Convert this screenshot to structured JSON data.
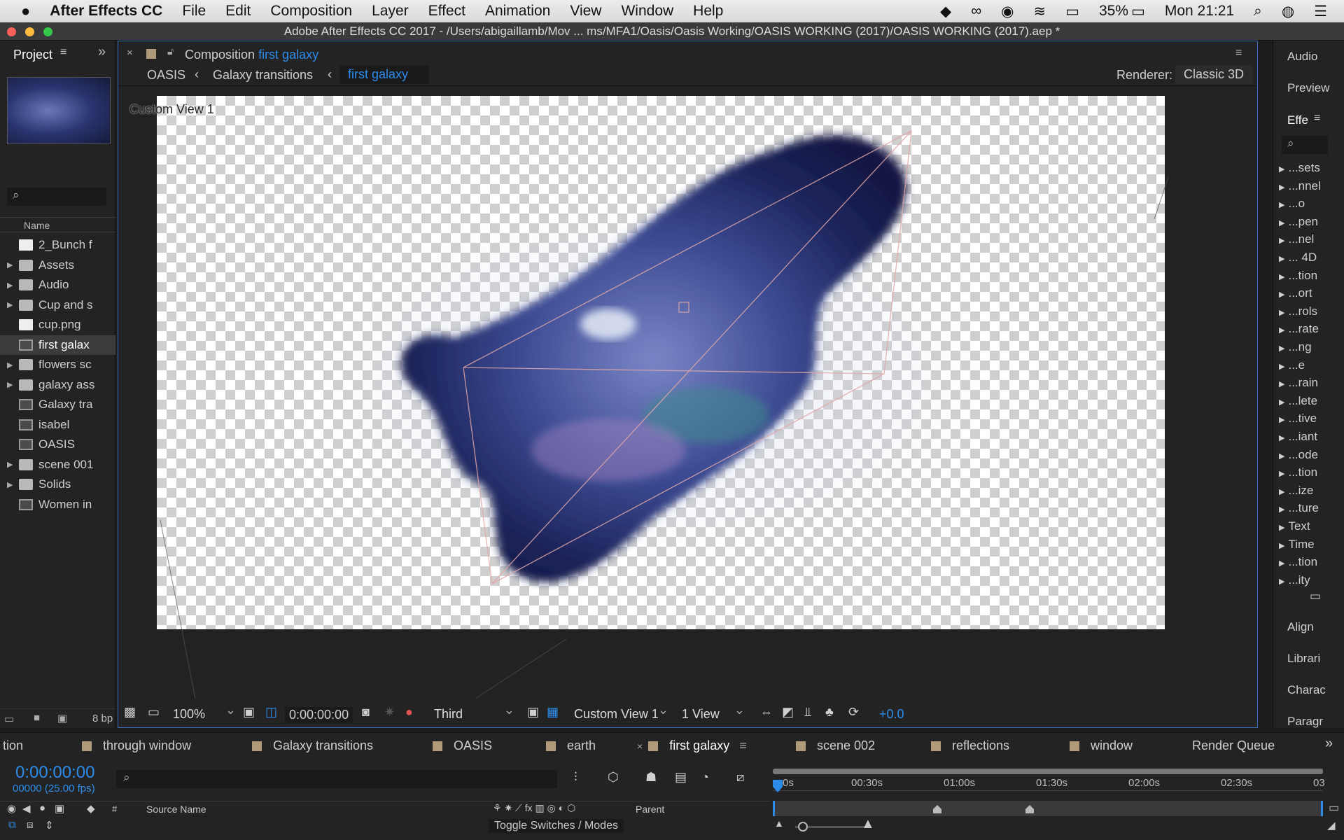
{
  "menubar": {
    "app": "After Effects CC",
    "items": [
      "File",
      "Edit",
      "Composition",
      "Layer",
      "Effect",
      "Animation",
      "View",
      "Window",
      "Help"
    ],
    "battery": "35%",
    "clock": "Mon 21:21"
  },
  "window_title": "Adobe After Effects CC 2017 - /Users/abigaillamb/Mov ... ms/MFA1/Oasis/Oasis Working/OASIS WORKING (2017)/OASIS WORKING (2017).aep *",
  "project": {
    "tab": "Project",
    "name_header": "Name",
    "footer_bpc": "8 bp",
    "items": [
      {
        "label": "2_Bunch f",
        "type": "file",
        "tri": ""
      },
      {
        "label": "Assets",
        "type": "folder",
        "tri": "▶"
      },
      {
        "label": "Audio",
        "type": "folder",
        "tri": "▶"
      },
      {
        "label": "Cup and s",
        "type": "folder",
        "tri": "▶"
      },
      {
        "label": "cup.png",
        "type": "file",
        "tri": ""
      },
      {
        "label": "first galax",
        "type": "comp",
        "tri": ""
      },
      {
        "label": "flowers sc",
        "type": "folder",
        "tri": "▶"
      },
      {
        "label": "galaxy ass",
        "type": "folder",
        "tri": "▶"
      },
      {
        "label": "Galaxy tra",
        "type": "comp",
        "tri": ""
      },
      {
        "label": "isabel",
        "type": "comp",
        "tri": ""
      },
      {
        "label": "OASIS",
        "type": "comp",
        "tri": ""
      },
      {
        "label": "scene 001",
        "type": "folder",
        "tri": "▶"
      },
      {
        "label": "Solids",
        "type": "folder",
        "tri": "▶"
      },
      {
        "label": "Women in",
        "type": "comp",
        "tri": ""
      }
    ]
  },
  "viewer": {
    "panel_prefix": "Composition",
    "comp_name": "first galaxy",
    "breadcrumbs": [
      "OASIS",
      "Galaxy transitions",
      "first galaxy"
    ],
    "renderer_label": "Renderer:",
    "renderer_value": "Classic 3D",
    "view_label": "Custom View 1",
    "zoom": "100%",
    "timecode": "0:00:00:00",
    "resolution": "Third",
    "active_camera": "Custom View 1",
    "views": "1 View",
    "exposure": "+0.0"
  },
  "right_panel": {
    "top_tabs": [
      "Audio",
      "Preview",
      "Effe"
    ],
    "items": [
      "...sets",
      "...nnel",
      "...o",
      "...pen",
      "...nel",
      "... 4D",
      "...tion",
      "...ort",
      "...rols",
      "...rate",
      "...ng",
      "...e",
      "...rain",
      "...lete",
      "...tive",
      "...iant",
      "...ode",
      "...tion",
      "...ize",
      "...ture",
      "Text",
      "Time",
      "...tion",
      "...ity"
    ],
    "bottom_tabs": [
      "Align",
      "Librari",
      "Charac",
      "Paragr"
    ]
  },
  "timeline_tabs": [
    "tion",
    "through window",
    "Galaxy transitions",
    "OASIS",
    "earth",
    "first galaxy",
    "scene 002",
    "reflections",
    "window",
    "Render Queue"
  ],
  "timeline": {
    "timecode": "0:00:00:00",
    "frames": "00000 (25.00 fps)",
    "col_source": "Source Name",
    "col_parent": "Parent",
    "col_hash": "#",
    "ruler": [
      "0s",
      "00:30s",
      "01:00s",
      "01:30s",
      "02:00s",
      "02:30s",
      "03"
    ],
    "toggle_label": "Toggle Switches / Modes"
  },
  "colors": {
    "accent": "#2d8ceb",
    "selection": "#3d6ec0"
  }
}
